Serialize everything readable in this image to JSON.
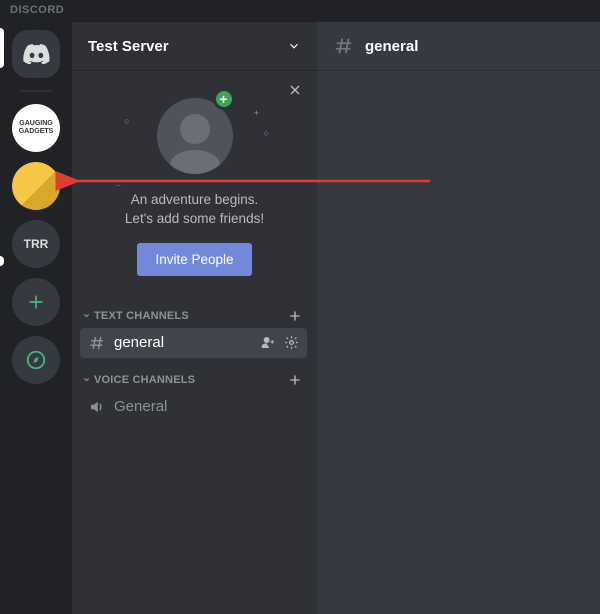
{
  "app": {
    "title": "DISCORD"
  },
  "colors": {
    "blurple": "#7289da",
    "green": "#3ba55c"
  },
  "guilds": {
    "list": [
      {
        "name": "home",
        "label": ""
      },
      {
        "name": "gauging-gadgets",
        "label": "GAUGING GADGETS"
      },
      {
        "name": "lego",
        "label": ""
      },
      {
        "name": "trr",
        "label": "TRR"
      }
    ],
    "add_tooltip": "+",
    "explore_tooltip": ""
  },
  "server": {
    "name": "Test Server"
  },
  "welcome": {
    "line1": "An adventure begins.",
    "line2": "Let's add some friends!",
    "invite_button": "Invite People"
  },
  "channels": {
    "text_header": "TEXT CHANNELS",
    "voice_header": "VOICE CHANNELS",
    "text": [
      {
        "name": "general",
        "active": true
      }
    ],
    "voice": [
      {
        "name": "General"
      }
    ]
  },
  "main": {
    "channel_name": "general"
  }
}
